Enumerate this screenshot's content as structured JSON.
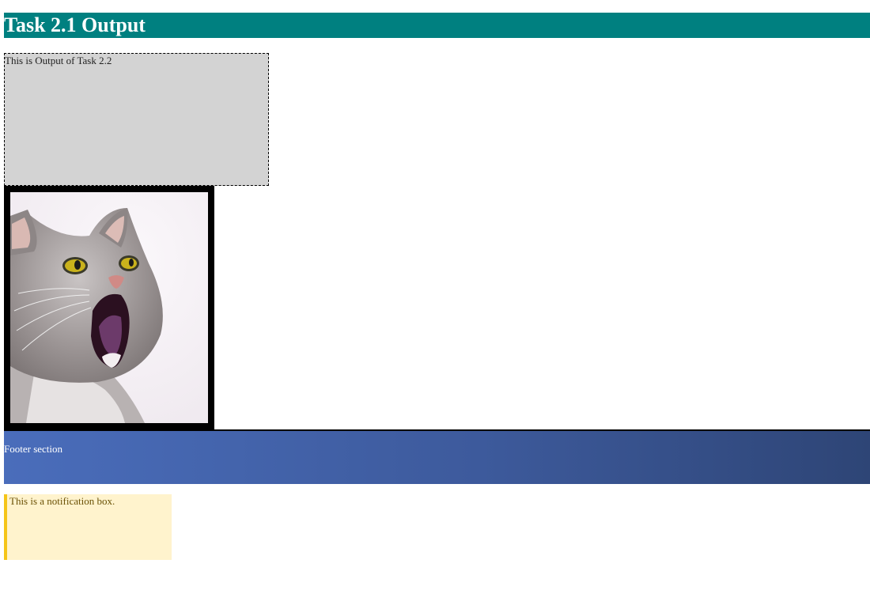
{
  "header": {
    "title": "Task 2.1 Output"
  },
  "gray_box": {
    "text": "This is Output of Task 2.2"
  },
  "image": {
    "subject": "cat-photo",
    "alt": ""
  },
  "footer": {
    "text": "Footer section"
  },
  "notification": {
    "text": "This is a notification box."
  },
  "colors": {
    "header_bg": "#008080",
    "box_bg": "#d3d3d3",
    "footer_gradient_start": "#4a6dbb",
    "footer_gradient_end": "#2e4576",
    "notification_bg": "#fff3cd",
    "notification_accent": "#f5c518"
  }
}
